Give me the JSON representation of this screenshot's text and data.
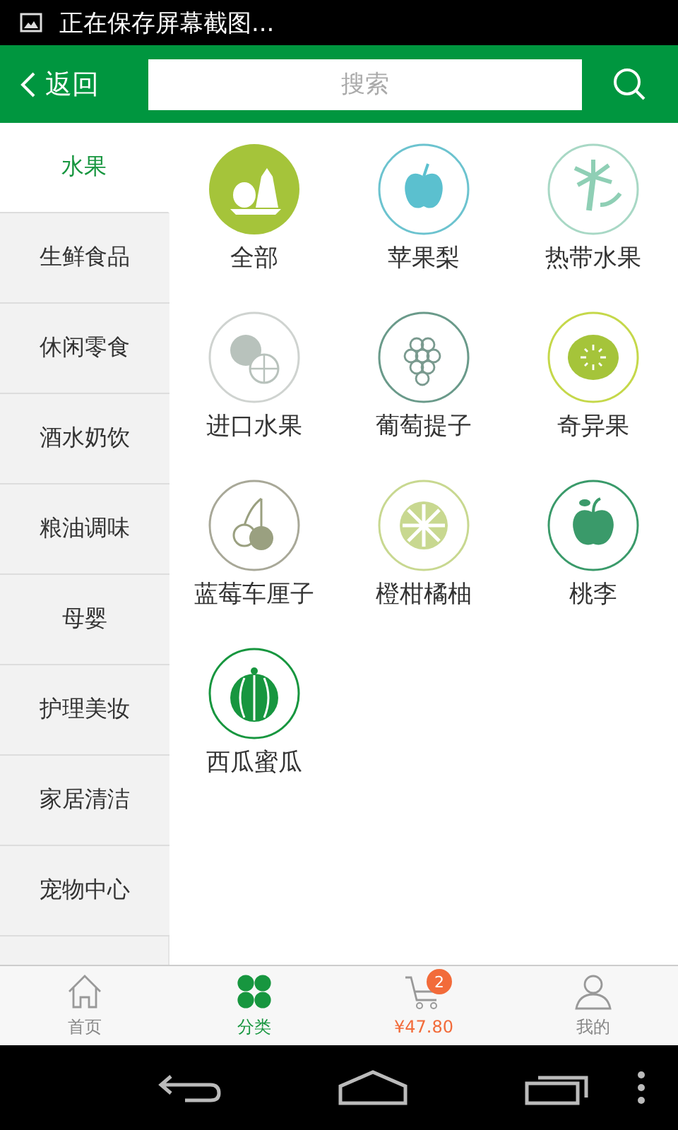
{
  "status_bar": {
    "notification": "正在保存屏幕截图..."
  },
  "header": {
    "back": "返回",
    "search": {
      "placeholder": "搜索"
    }
  },
  "sidebar": {
    "items": [
      {
        "label": "水果",
        "selected": true
      },
      {
        "label": "生鲜食品",
        "selected": false
      },
      {
        "label": "休闲零食",
        "selected": false
      },
      {
        "label": "酒水奶饮",
        "selected": false
      },
      {
        "label": "粮油调味",
        "selected": false
      },
      {
        "label": "母婴",
        "selected": false
      },
      {
        "label": "护理美妆",
        "selected": false
      },
      {
        "label": "家居清洁",
        "selected": false
      },
      {
        "label": "宠物中心",
        "selected": false
      }
    ]
  },
  "categories": [
    {
      "label": "全部",
      "kind": "all"
    },
    {
      "label": "苹果梨",
      "kind": "apple"
    },
    {
      "label": "热带水果",
      "kind": "palm"
    },
    {
      "label": "进口水果",
      "kind": "import"
    },
    {
      "label": "葡萄提子",
      "kind": "grape"
    },
    {
      "label": "奇异果",
      "kind": "kiwi"
    },
    {
      "label": "蓝莓车厘子",
      "kind": "cherry"
    },
    {
      "label": "橙柑橘柚",
      "kind": "citrus"
    },
    {
      "label": "桃李",
      "kind": "peach"
    },
    {
      "label": "西瓜蜜瓜",
      "kind": "melon"
    }
  ],
  "tab_bar": [
    {
      "label": "首页",
      "kind": "home",
      "selected": false
    },
    {
      "label": "分类",
      "kind": "category",
      "selected": true
    },
    {
      "label": "¥47.80",
      "kind": "cart",
      "badge": "2",
      "selected": false
    },
    {
      "label": "我的",
      "kind": "user",
      "selected": false
    }
  ]
}
